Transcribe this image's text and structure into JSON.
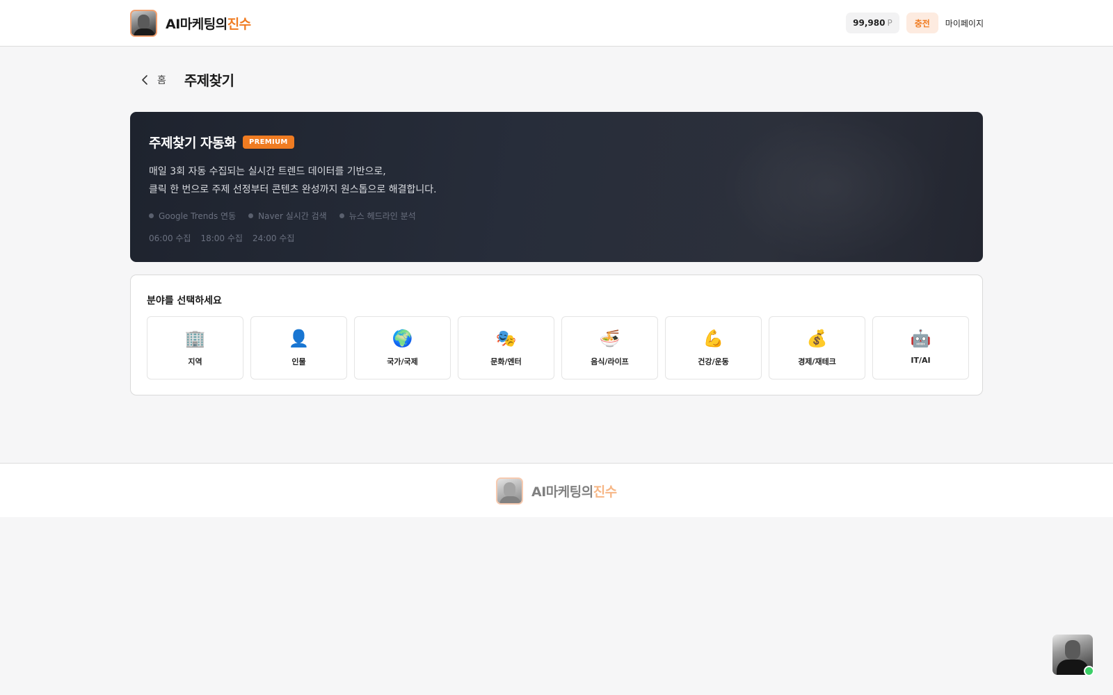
{
  "header": {
    "logo": {
      "main": "AI마케팅의",
      "accent": "진수"
    },
    "points": {
      "value": "99,980",
      "unit": "P"
    },
    "charge_label": "충전",
    "mypage_label": "마이페이지"
  },
  "breadcrumb": {
    "home_label": "홈"
  },
  "page_title": "주제찾기",
  "hero": {
    "title": "주제찾기 자동화",
    "badge": "PREMIUM",
    "description": [
      "매일 3회 자동 수집되는 실시간 트렌드 데이터를 기반으로,",
      "클릭 한 번으로 주제 선정부터 콘텐츠 완성까지 원스톱으로 해결합니다."
    ],
    "tags": [
      "Google Trends 연동",
      "Naver 실시간 검색",
      "뉴스 헤드라인 분석"
    ],
    "times": [
      "06:00 수집",
      "18:00 수집",
      "24:00 수집"
    ]
  },
  "category_panel": {
    "title": "분야를 선택하세요",
    "categories": [
      {
        "label": "지역",
        "icon": "building-icon",
        "glyph": "🏢"
      },
      {
        "label": "인물",
        "icon": "person-icon",
        "glyph": "👤"
      },
      {
        "label": "국가/국제",
        "icon": "globe-icon",
        "glyph": "🌍"
      },
      {
        "label": "문화/엔터",
        "icon": "theater-masks-icon",
        "glyph": "🎭"
      },
      {
        "label": "음식/라이프",
        "icon": "noodle-bowl-icon",
        "glyph": "🍜"
      },
      {
        "label": "건강/운동",
        "icon": "flexed-biceps-icon",
        "glyph": "💪"
      },
      {
        "label": "경제/재테크",
        "icon": "money-bag-icon",
        "glyph": "💰"
      },
      {
        "label": "IT/AI",
        "icon": "robot-icon",
        "glyph": "🤖"
      }
    ]
  },
  "footer": {
    "logo": {
      "main": "AI마케팅의",
      "accent": "진수"
    }
  },
  "colors": {
    "accent": "#f07c22",
    "hero_bg": "#232835",
    "online": "#3ccf68"
  }
}
